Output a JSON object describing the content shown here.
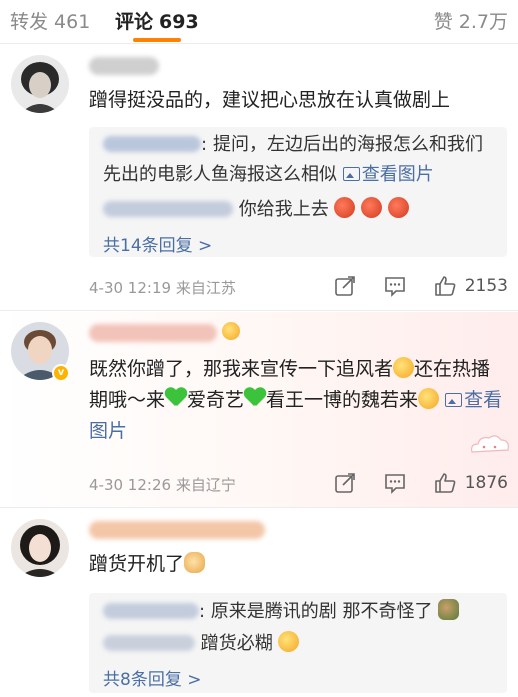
{
  "tabs": {
    "reposts": {
      "label": "转发",
      "count": "461"
    },
    "comments": {
      "label": "评论",
      "count": "693"
    },
    "likes": {
      "label": "赞",
      "count": "2.7万"
    }
  },
  "comments": [
    {
      "username": "",
      "text": "蹭得挺没品的，建议把心思放在认真做剧上",
      "replies": [
        {
          "text": "提问，左边后出的海报怎么和我们先出的电影人鱼海报这么相似",
          "link": "查看图片"
        },
        {
          "text": "你给我上去"
        }
      ],
      "more": "共14条回复 >",
      "time": "4-30 12:19",
      "source": "来自江苏",
      "likes": "2153"
    },
    {
      "username": "",
      "text_parts": [
        "既然你蹭了，那我来宣传一下追风者",
        "还在热播期哦～来",
        "爱奇艺",
        "看王一博的魏若来"
      ],
      "link": "查看图片",
      "time": "4-30 12:26",
      "source": "来自辽宁",
      "likes": "1876"
    },
    {
      "username": "",
      "text": "蹭货开机了",
      "replies": [
        {
          "text": "原来是腾讯的剧 那不奇怪了"
        },
        {
          "text": "蹭货必糊"
        }
      ],
      "more": "共8条回复 >"
    }
  ],
  "colors": {
    "accent": "#ff8200",
    "link": "#4a6fa5",
    "meta": "#999999"
  },
  "icons": [
    "repost-icon",
    "comment-icon",
    "like-icon",
    "picture-icon"
  ]
}
